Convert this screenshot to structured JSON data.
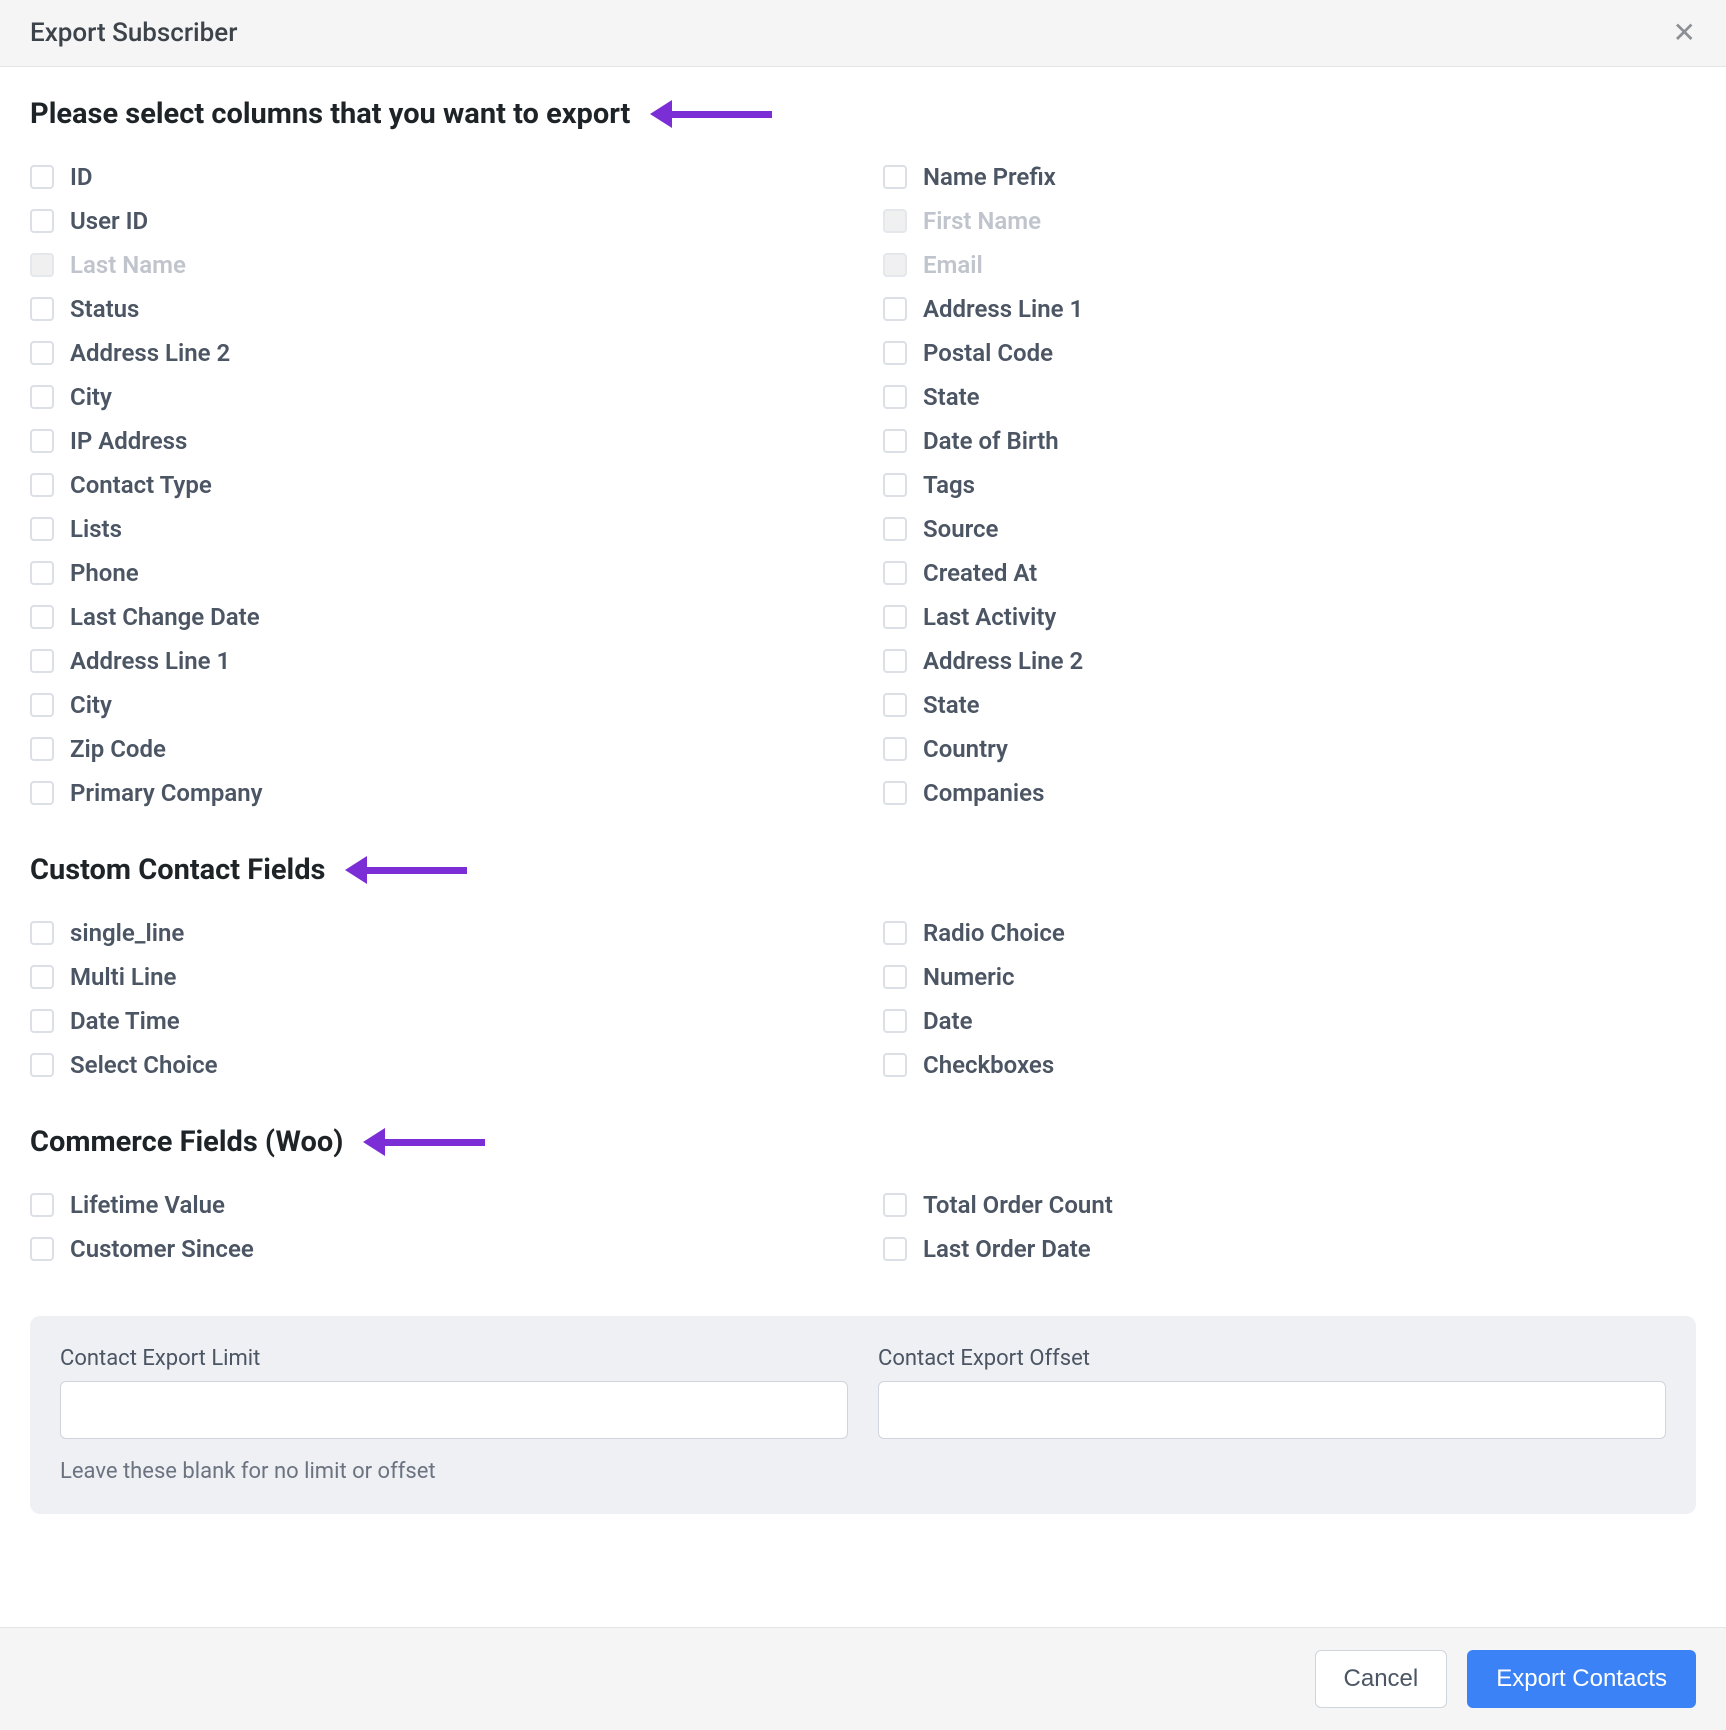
{
  "header": {
    "title": "Export Subscriber"
  },
  "sections": {
    "columns": {
      "title": "Please select columns that you want to export",
      "left": [
        {
          "label": "ID",
          "disabled": false
        },
        {
          "label": "User ID",
          "disabled": false
        },
        {
          "label": "Last Name",
          "disabled": true
        },
        {
          "label": "Status",
          "disabled": false
        },
        {
          "label": "Address Line 2",
          "disabled": false
        },
        {
          "label": "City",
          "disabled": false
        },
        {
          "label": "IP Address",
          "disabled": false
        },
        {
          "label": "Contact Type",
          "disabled": false
        },
        {
          "label": "Lists",
          "disabled": false
        },
        {
          "label": "Phone",
          "disabled": false
        },
        {
          "label": "Last Change Date",
          "disabled": false
        },
        {
          "label": "Address Line 1",
          "disabled": false
        },
        {
          "label": "City",
          "disabled": false
        },
        {
          "label": "Zip Code",
          "disabled": false
        },
        {
          "label": "Primary Company",
          "disabled": false
        }
      ],
      "right": [
        {
          "label": "Name Prefix",
          "disabled": false
        },
        {
          "label": "First Name",
          "disabled": true
        },
        {
          "label": "Email",
          "disabled": true
        },
        {
          "label": "Address Line 1",
          "disabled": false
        },
        {
          "label": "Postal Code",
          "disabled": false
        },
        {
          "label": "State",
          "disabled": false
        },
        {
          "label": "Date of Birth",
          "disabled": false
        },
        {
          "label": "Tags",
          "disabled": false
        },
        {
          "label": "Source",
          "disabled": false
        },
        {
          "label": "Created At",
          "disabled": false
        },
        {
          "label": "Last Activity",
          "disabled": false
        },
        {
          "label": "Address Line 2",
          "disabled": false
        },
        {
          "label": "State",
          "disabled": false
        },
        {
          "label": "Country",
          "disabled": false
        },
        {
          "label": "Companies",
          "disabled": false
        }
      ]
    },
    "custom": {
      "title": "Custom Contact Fields",
      "left": [
        {
          "label": "single_line"
        },
        {
          "label": "Multi Line"
        },
        {
          "label": "Date Time"
        },
        {
          "label": "Select Choice"
        }
      ],
      "right": [
        {
          "label": "Radio Choice"
        },
        {
          "label": "Numeric"
        },
        {
          "label": "Date"
        },
        {
          "label": "Checkboxes"
        }
      ]
    },
    "commerce": {
      "title": "Commerce Fields (Woo)",
      "left": [
        {
          "label": "Lifetime Value"
        },
        {
          "label": "Customer Sincee"
        }
      ],
      "right": [
        {
          "label": "Total Order Count"
        },
        {
          "label": "Last Order Date"
        }
      ]
    }
  },
  "settings": {
    "limit_label": "Contact Export Limit",
    "offset_label": "Contact Export Offset",
    "limit_value": "",
    "offset_value": "",
    "hint": "Leave these blank for no limit or offset"
  },
  "footer": {
    "cancel": "Cancel",
    "export": "Export Contacts"
  }
}
